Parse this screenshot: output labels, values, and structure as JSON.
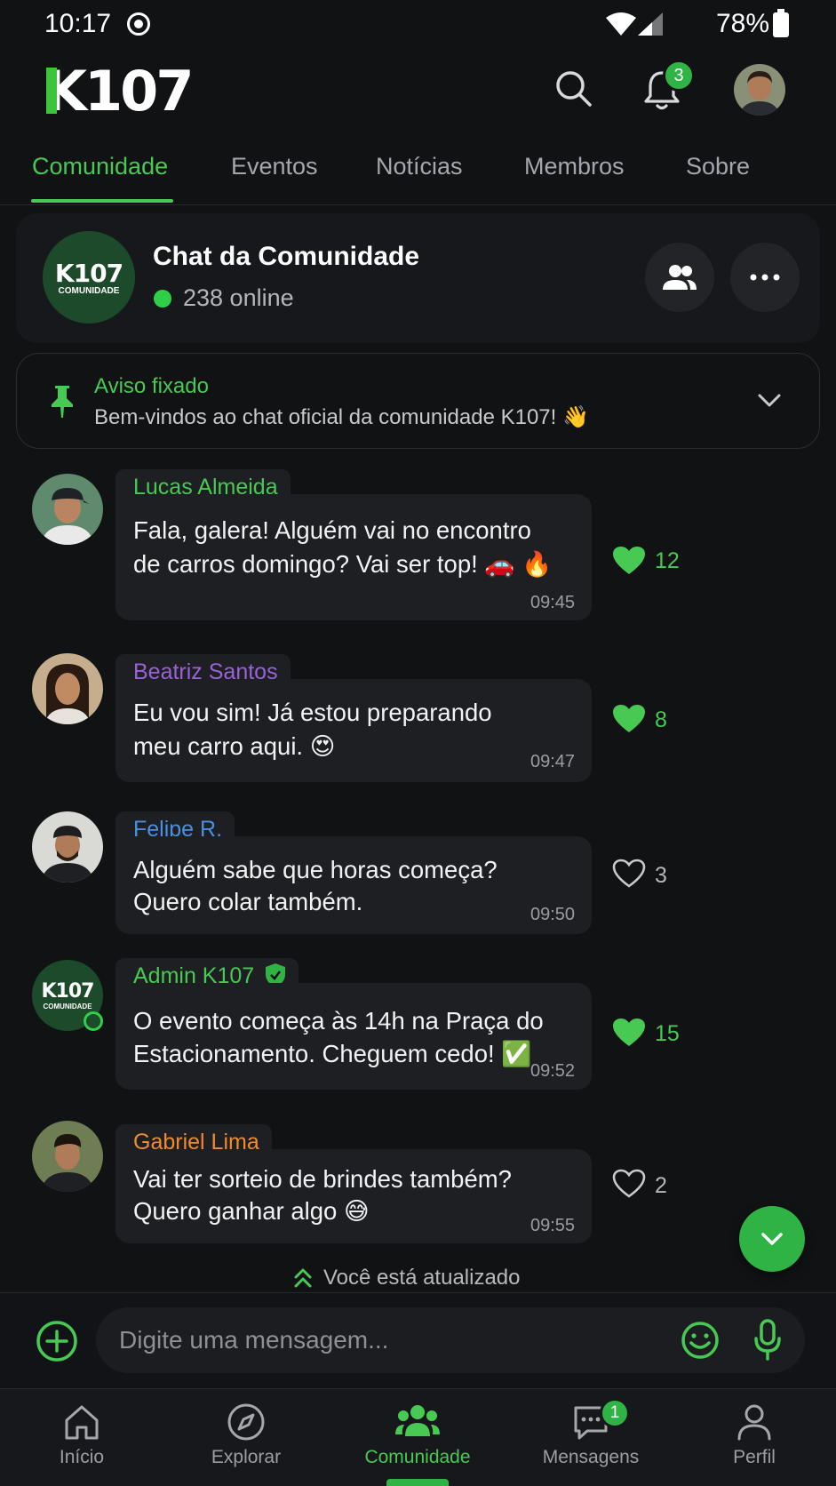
{
  "status_bar": {
    "time": "10:17",
    "battery": "78%"
  },
  "header": {
    "logo_k": "K",
    "logo_num": "107",
    "notification_count": "3"
  },
  "tabs": [
    {
      "label": "Comunidade",
      "active": true
    },
    {
      "label": "Eventos"
    },
    {
      "label": "Notícias"
    },
    {
      "label": "Membros"
    },
    {
      "label": "Sobre"
    }
  ],
  "chat": {
    "title": "Chat da Comunidade",
    "online": "238 online",
    "avatar_line1": "K107",
    "avatar_line2": "COMUNIDADE"
  },
  "pinned": {
    "title": "Aviso fixado",
    "text": "Bem-vindos ao chat oficial da comunidade K107! 👋"
  },
  "messages": [
    {
      "sender": "Lucas Almeida",
      "sender_color": "#48c953",
      "lines": [
        "Fala, galera! Alguém vai no encontro",
        "de carros domingo? Vai ser top! 🚗 🔥"
      ],
      "time": "09:45",
      "likes": "12",
      "liked": true
    },
    {
      "sender": "Beatriz Santos",
      "sender_color": "#9a62d8",
      "lines": [
        "Eu vou sim! Já estou preparando",
        "meu carro aqui. 😍"
      ],
      "time": "09:47",
      "likes": "8",
      "liked": true
    },
    {
      "sender": "Felipe R.",
      "sender_color": "#4a90e2",
      "lines": [
        "Alguém sabe que horas começa?",
        "Quero colar também."
      ],
      "time": "09:50",
      "likes": "3",
      "liked": false
    },
    {
      "sender": "Admin K107",
      "sender_color": "#48c953",
      "lines": [
        "O evento começa às 14h na Praça do",
        "Estacionamento. Cheguem cedo! ✅"
      ],
      "time": "09:52",
      "likes": "15",
      "liked": true,
      "avatar_line1": "K107",
      "avatar_line2": "COMUNIDADE"
    },
    {
      "sender": "Gabriel Lima",
      "sender_color": "#f08a2a",
      "lines": [
        "Vai ter sorteio de brindes também?",
        "Quero ganhar algo 😅"
      ],
      "time": "09:55",
      "likes": "2",
      "liked": false
    }
  ],
  "updated_text": "Você está atualizado",
  "composer": {
    "placeholder": "Digite uma mensagem..."
  },
  "bottom_nav": [
    {
      "label": "Início",
      "icon": "home-icon"
    },
    {
      "label": "Explorar",
      "icon": "compass-icon"
    },
    {
      "label": "Comunidade",
      "icon": "community-icon",
      "active": true
    },
    {
      "label": "Mensagens",
      "icon": "chat-icon",
      "badge": "1"
    },
    {
      "label": "Perfil",
      "icon": "user-icon"
    }
  ],
  "colors": {
    "accent": "#48c953",
    "background": "#111214",
    "bubble": "#1e1f22"
  }
}
